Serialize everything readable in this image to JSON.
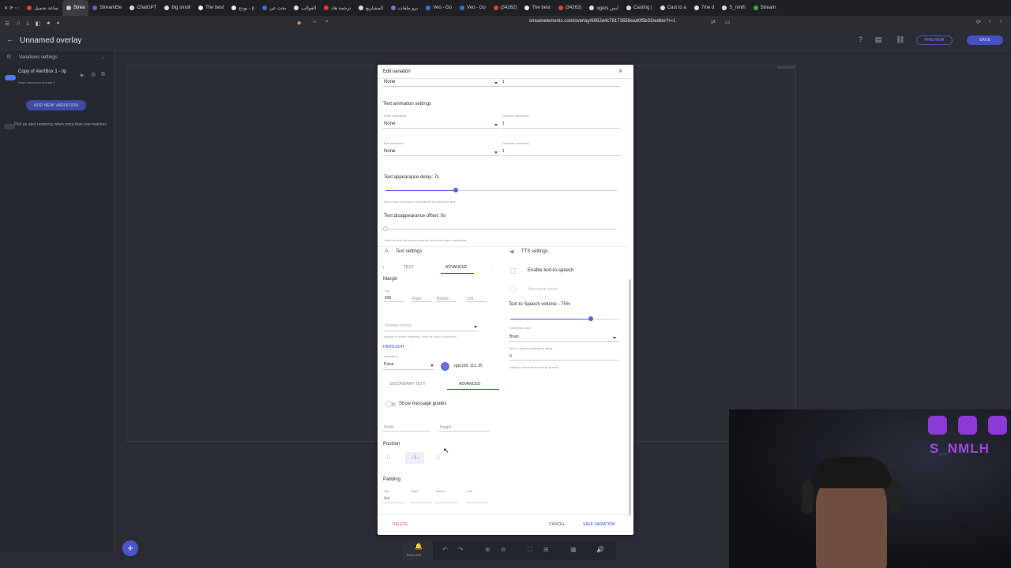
{
  "browser": {
    "tabs": [
      {
        "label": "ساعد تحميل",
        "color": "#e04040"
      },
      {
        "label": "Strea",
        "color": "#cccccc",
        "active": true
      },
      {
        "label": "StreamEle",
        "color": "#6a5cd8"
      },
      {
        "label": "ChatGPT",
        "color": "#dddddd"
      },
      {
        "label": "big smoll",
        "color": "#dddddd"
      },
      {
        "label": "The best",
        "color": "#eeeeee"
      },
      {
        "label": "بودع - p",
        "color": "#eeeeee"
      },
      {
        "label": "بحث عن",
        "color": "#3b6fd8"
      },
      {
        "label": "القوالب",
        "color": "#dddddd"
      },
      {
        "label": "ترجمة هاد",
        "color": "#e04040"
      },
      {
        "label": "المشاريع",
        "color": "#dddddd"
      },
      {
        "label": "برو ملفات",
        "color": "#8a6ad8"
      },
      {
        "label": "Veo - Go",
        "color": "#3b6fd8"
      },
      {
        "label": "Veo - Go",
        "color": "#3b6fd8"
      },
      {
        "label": "(34262)",
        "color": "#e04040"
      },
      {
        "label": "The best",
        "color": "#eeeeee"
      },
      {
        "label": "(34262)",
        "color": "#e04040"
      },
      {
        "label": "ogers أبس",
        "color": "#dddddd"
      },
      {
        "label": "Casting |",
        "color": "#dddddd"
      },
      {
        "label": "Cast to a",
        "color": "#dddddd"
      },
      {
        "label": "7me d",
        "color": "#dddddd"
      },
      {
        "label": "S_nmlh",
        "color": "#dddddd"
      },
      {
        "label": "Stream",
        "color": "#30b040"
      }
    ],
    "url": "streamelements.com/overlay/6952e4c78173658ead0f5b33/editor?r=1"
  },
  "app": {
    "title": "Unnamed overlay",
    "preview_label": "PREVIEW",
    "save_label": "SAVE",
    "emulate_label": "EMULATE"
  },
  "sidebar": {
    "header": "Variations settings",
    "variation_name": "Copy of AlertBox 1 - tip",
    "variation_sub": "When amount is at least 1",
    "add_variation": "ADD NEW VARIATION",
    "random_text": "Pick an alert randomly when more than one matches"
  },
  "modal": {
    "title": "Edit variation",
    "top_select_value": "None",
    "top_duration_value": "1",
    "text_animation_header": "Text animation settings",
    "enter_animation_label": "Enter animation",
    "enter_animation_value": "None",
    "enter_duration_label": "Duration (seconds)",
    "enter_duration_value": "1",
    "exit_animation_label": "Exit animation",
    "exit_animation_value": "None",
    "exit_duration_label": "Duration (seconds)",
    "exit_duration_value": "1",
    "appearance_delay_label": "Text appearance delay: 7s",
    "appearance_delay_value": 7,
    "appearance_delay_help": "How many seconds to wait before showing the text",
    "disappearance_label": "Text disappearance offset: 0s",
    "disappearance_value": 0,
    "disappearance_help": "Hide the text this many seconds before the alert completes.",
    "text_settings_label": "Text settings",
    "tts_settings_label": "TTS settings",
    "tab_text": "TEXT",
    "tab_advanced": "ADVANCED",
    "margin_label": "Margin",
    "margin_top_label": "Top",
    "margin_top_value": "600",
    "margin_right": "Right",
    "margin_bottom": "Bottom",
    "margin_left": "Left",
    "number_format_placeholder": "Number format",
    "number_format_help": "Applies to event variables, such as count or amount.",
    "highlight_label": "HIGHLIGHT",
    "animation_label": "Animation",
    "animation_value": "Pulse",
    "highlight_color_text": "rgb(106, 111, 25",
    "highlight_color": "#6a6fe6",
    "tab_secondary_text": "SECONDARY TEXT",
    "tab_advanced_2": "ADVANCED",
    "show_guides_label": "Show message guides",
    "width_label": "Width",
    "height_label": "Height",
    "position_label": "Position",
    "padding_label": "Padding",
    "padding_top": "Top",
    "padding_top_value": "Aut",
    "padding_right": "Right",
    "padding_bottom": "Bottom",
    "padding_left": "Left",
    "tts_enable_label": "Enable text-to-speech",
    "tts_announce_label": "Announce action",
    "tts_volume_label": "Text to Speech volume - 75%",
    "tts_volume_value": 75,
    "tts_voice_label": "Select tts voice",
    "tts_voice_value": "Brian",
    "tts_delay_label": "Text to speech activation delay",
    "tts_delay_value": "0",
    "tts_delay_help": "Delay in seconds for text to speech",
    "delete_label": "DELETE",
    "cancel_label": "CANCEL",
    "save_label": "SAVE VARIATION"
  },
  "webcam": {
    "overlay_text": "S_NMLH"
  },
  "colors": {
    "accent": "#3b4bd8",
    "danger": "#e05060",
    "brand_purple": "#7a3ccf"
  }
}
